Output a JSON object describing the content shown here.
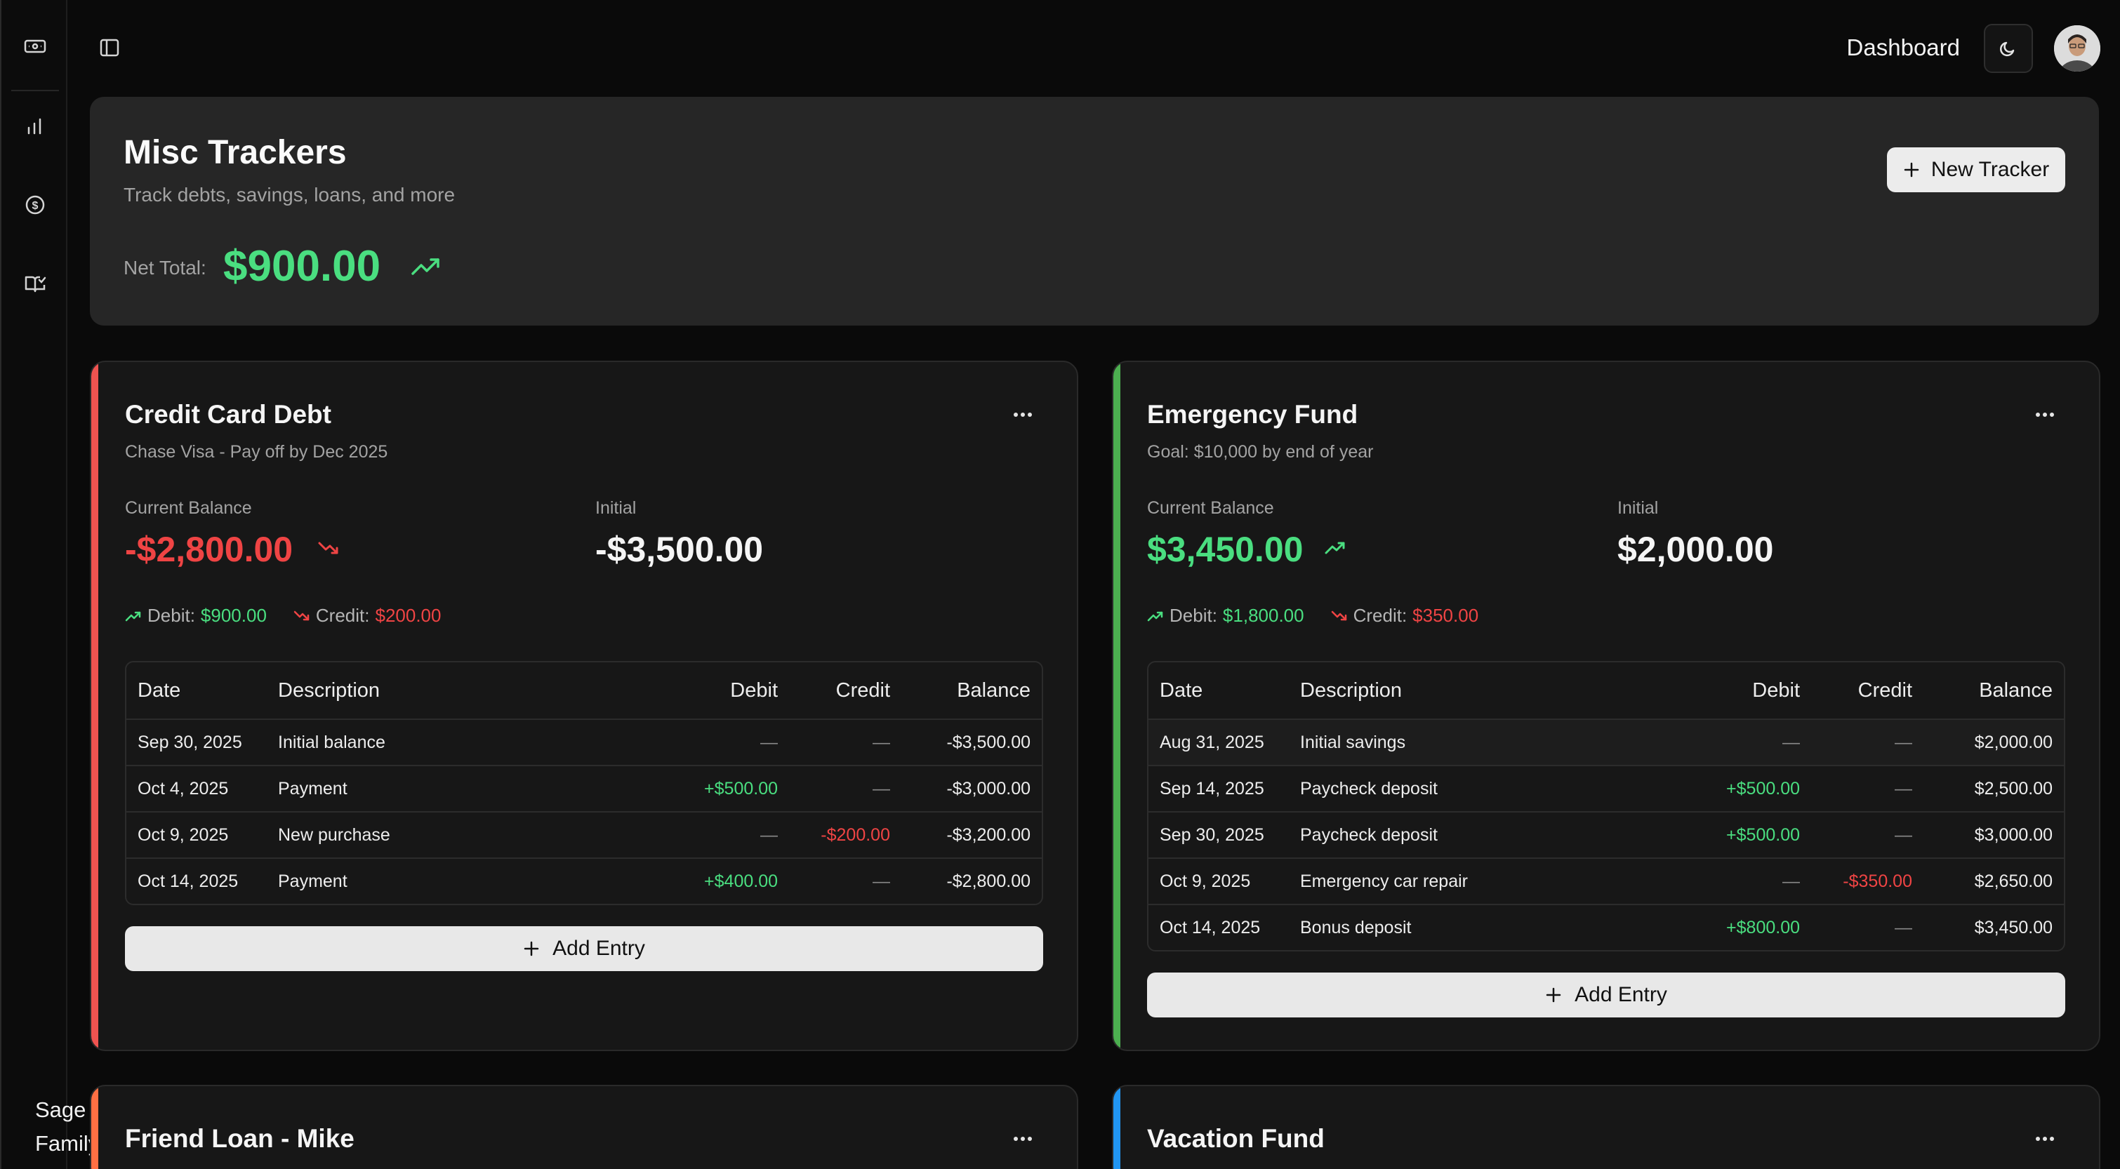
{
  "app": {
    "brand_line1": "Sage",
    "brand_line2": "Family"
  },
  "topbar": {
    "breadcrumb": "Dashboard"
  },
  "header": {
    "title": "Misc Trackers",
    "subtitle": "Track debts, savings, loans, and more",
    "net_label": "Net Total:",
    "net_value": "$900.00",
    "new_button": "New Tracker"
  },
  "colors": {
    "positive": "#4ade80",
    "negative": "#ef4444",
    "debt_accent": "#ef5350",
    "savings_accent": "#4caf50",
    "loan_accent": "#ff7043",
    "vacation_accent": "#2196f3"
  },
  "table_headers": {
    "date": "Date",
    "description": "Description",
    "debit": "Debit",
    "credit": "Credit",
    "balance": "Balance"
  },
  "trackers": [
    {
      "title": "Credit Card Debt",
      "subtitle": "Chase Visa - Pay off by Dec 2025",
      "current_label": "Current Balance",
      "current_value": "-$2,800.00",
      "initial_label": "Initial",
      "initial_value": "-$3,500.00",
      "debit_label": "Debit:",
      "debit_value": "$900.00",
      "credit_label": "Credit:",
      "credit_value": "$200.00",
      "add_label": "Add Entry",
      "rows": [
        {
          "date": "Sep 30, 2025",
          "description": "Initial balance",
          "debit": "—",
          "credit": "—",
          "balance": "-$3,500.00"
        },
        {
          "date": "Oct 4, 2025",
          "description": "Payment",
          "debit": "+$500.00",
          "credit": "—",
          "balance": "-$3,000.00"
        },
        {
          "date": "Oct 9, 2025",
          "description": "New purchase",
          "debit": "—",
          "credit": "-$200.00",
          "balance": "-$3,200.00"
        },
        {
          "date": "Oct 14, 2025",
          "description": "Payment",
          "debit": "+$400.00",
          "credit": "—",
          "balance": "-$2,800.00"
        }
      ]
    },
    {
      "title": "Emergency Fund",
      "subtitle": "Goal: $10,000 by end of year",
      "current_label": "Current Balance",
      "current_value": "$3,450.00",
      "initial_label": "Initial",
      "initial_value": "$2,000.00",
      "debit_label": "Debit:",
      "debit_value": "$1,800.00",
      "credit_label": "Credit:",
      "credit_value": "$350.00",
      "add_label": "Add Entry",
      "rows": [
        {
          "date": "Aug 31, 2025",
          "description": "Initial savings",
          "debit": "—",
          "credit": "—",
          "balance": "$2,000.00"
        },
        {
          "date": "Sep 14, 2025",
          "description": "Paycheck deposit",
          "debit": "+$500.00",
          "credit": "—",
          "balance": "$2,500.00"
        },
        {
          "date": "Sep 30, 2025",
          "description": "Paycheck deposit",
          "debit": "+$500.00",
          "credit": "—",
          "balance": "$3,000.00"
        },
        {
          "date": "Oct 9, 2025",
          "description": "Emergency car repair",
          "debit": "—",
          "credit": "-$350.00",
          "balance": "$2,650.00"
        },
        {
          "date": "Oct 14, 2025",
          "description": "Bonus deposit",
          "debit": "+$800.00",
          "credit": "—",
          "balance": "$3,450.00"
        }
      ]
    },
    {
      "title": "Friend Loan - Mike"
    },
    {
      "title": "Vacation Fund"
    }
  ]
}
